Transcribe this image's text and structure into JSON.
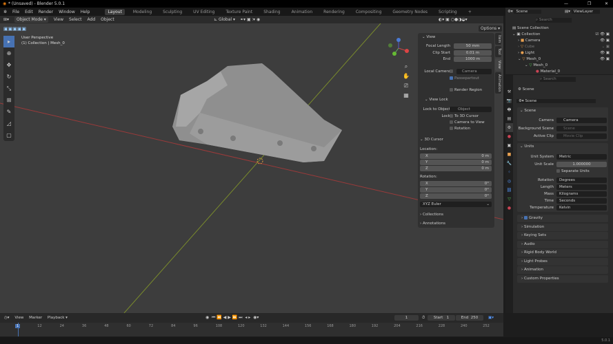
{
  "window": {
    "title": "* (Unsaved) - Blender 5.0.1",
    "minimize": "—",
    "maximize": "❐",
    "close": "✕"
  },
  "menu": [
    "File",
    "Edit",
    "Render",
    "Window",
    "Help"
  ],
  "workspaces": [
    "Layout",
    "Modeling",
    "Sculpting",
    "UV Editing",
    "Texture Paint",
    "Shading",
    "Animation",
    "Rendering",
    "Compositing",
    "Geometry Nodes",
    "Scripting",
    "+"
  ],
  "viewport": {
    "mode": "Object Mode",
    "menus": [
      "View",
      "Select",
      "Add",
      "Object"
    ],
    "orientation": "Global",
    "options": "Options",
    "overlay_title": "User Perspective",
    "overlay_sub": "(1) Collection | Mesh_0"
  },
  "npanel": {
    "tabs": [
      "Item",
      "Tool",
      "View",
      "Animation"
    ],
    "view_header": "View",
    "focal_label": "Focal Length",
    "focal": "50 mm",
    "clip_start_label": "Clip Start",
    "clip_start": "0.01 m",
    "end_label": "End",
    "clip_end": "1000 m",
    "local_camera_label": "Local Camera",
    "local_camera": "Camera",
    "passepartout": "Passepartout",
    "render_region": "Render Region",
    "view_lock_header": "View Lock",
    "lock_to_object_label": "Lock to Object",
    "lock_object": "Object",
    "lock_label": "Lock",
    "to_cursor": "To 3D Cursor",
    "camera_to_view": "Camera to View",
    "rotation": "Rotation",
    "cursor_header": "3D Cursor",
    "location_label": "Location:",
    "loc": [
      {
        "axis": "X",
        "value": "0 m"
      },
      {
        "axis": "Y",
        "value": "0 m"
      },
      {
        "axis": "Z",
        "value": "0 m"
      }
    ],
    "rotation_label": "Rotation:",
    "rot": [
      {
        "axis": "X",
        "value": "0°"
      },
      {
        "axis": "Y",
        "value": "0°"
      },
      {
        "axis": "Z",
        "value": "0°"
      }
    ],
    "rotation_mode": "XYZ Euler",
    "collections": "Collections",
    "annotations": "Annotations"
  },
  "outliner": {
    "scene": "Scene",
    "view_layer": "ViewLayer",
    "search": "Search",
    "items": [
      {
        "name": "Scene Collection",
        "indent": 0
      },
      {
        "name": "Collection",
        "indent": 1
      },
      {
        "name": "Camera",
        "indent": 2
      },
      {
        "name": "Cube",
        "indent": 2
      },
      {
        "name": "Light",
        "indent": 2
      },
      {
        "name": "Mesh_0",
        "indent": 2
      },
      {
        "name": "Mesh_0",
        "indent": 3
      },
      {
        "name": "Material_0",
        "indent": 4
      }
    ]
  },
  "properties": {
    "search": "Search",
    "context": "Scene",
    "scene_field": "Scene",
    "scene_header": "Scene",
    "camera_label": "Camera",
    "camera": "Camera",
    "bg_label": "Background Scene",
    "bg": "Scene",
    "clip_label": "Active Clip",
    "clip": "Movie Clip",
    "units_header": "Units",
    "unit_system_label": "Unit System",
    "unit_system": "Metric",
    "unit_scale_label": "Unit Scale",
    "unit_scale": "1.000000",
    "separate_units": "Separate Units",
    "rotation_label": "Rotation",
    "rotation": "Degrees",
    "length_label": "Length",
    "length": "Meters",
    "mass_label": "Mass",
    "mass": "Kilograms",
    "time_label": "Time",
    "time": "Seconds",
    "temp_label": "Temperature",
    "temp": "Kelvin",
    "panels": [
      "Gravity",
      "Simulation",
      "Keying Sets",
      "Audio",
      "Rigid Body World",
      "Light Probes",
      "Animation",
      "Custom Properties"
    ]
  },
  "timeline": {
    "menus": [
      "View",
      "Marker",
      "Playback"
    ],
    "current": "1",
    "start_label": "Start",
    "start": "1",
    "end_label": "End",
    "end": "250",
    "ticks": [
      "1",
      "12",
      "24",
      "36",
      "48",
      "60",
      "72",
      "84",
      "96",
      "108",
      "120",
      "132",
      "144",
      "156",
      "168",
      "180",
      "192",
      "204",
      "216",
      "228",
      "240",
      "252"
    ]
  },
  "status": {
    "version": "5.0.1"
  }
}
